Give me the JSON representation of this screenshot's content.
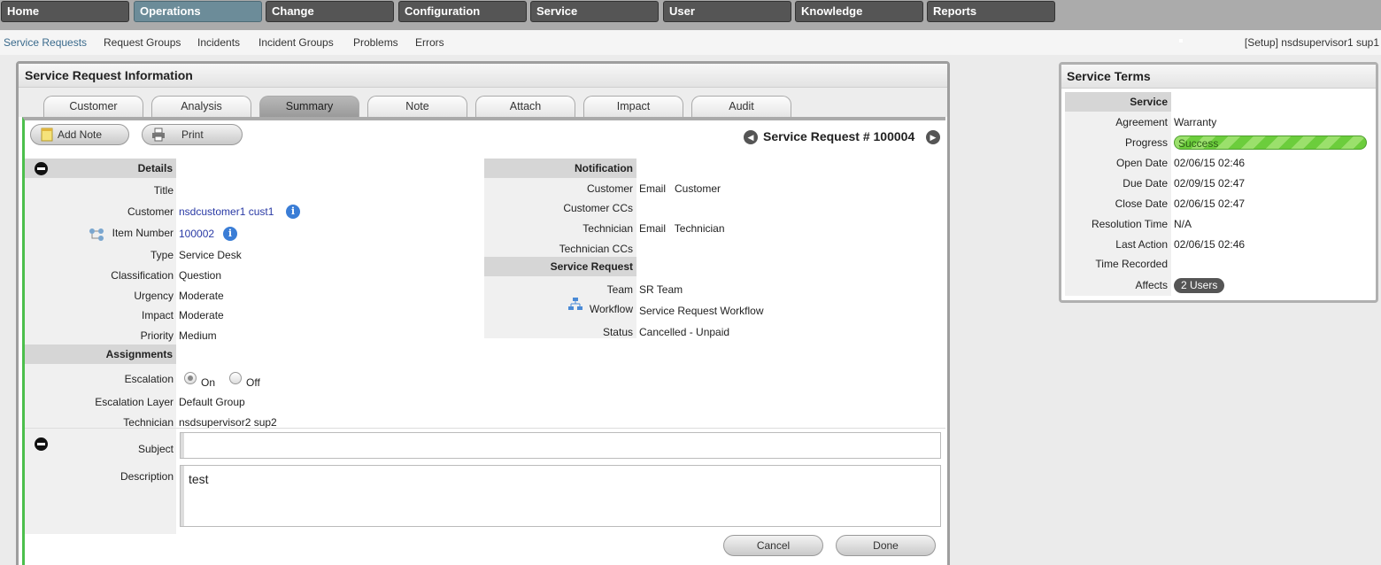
{
  "topnav": [
    "Home",
    "Operations",
    "Change",
    "Configuration",
    "Service",
    "User",
    "Knowledge",
    "Reports"
  ],
  "subnav": {
    "items": [
      "Service Requests",
      "Request Groups",
      "Incidents",
      "Incident Groups",
      "Problems",
      "Errors"
    ],
    "right": "[Setup]   nsdsupervisor1 sup1"
  },
  "panel": {
    "title": "Service Request Information",
    "tabs": [
      "Customer",
      "Analysis",
      "Summary",
      "Note",
      "Attach",
      "Impact",
      "Audit"
    ],
    "add_note": "Add Note",
    "print": "Print",
    "sr_title": "Service Request # 100004"
  },
  "details": {
    "header": "Details",
    "title_label": "Title",
    "customer_label": "Customer",
    "customer_value": "nsdcustomer1 cust1",
    "item_number_label": "Item Number",
    "item_number_value": "100002",
    "type_label": "Type",
    "type_value": "Service Desk",
    "classification_label": "Classification",
    "classification_value": "Question",
    "urgency_label": "Urgency",
    "urgency_value": "Moderate",
    "impact_label": "Impact",
    "impact_value": "Moderate",
    "priority_label": "Priority",
    "priority_value": "Medium"
  },
  "assignments": {
    "header": "Assignments",
    "escalation_label": "Escalation",
    "on": "On",
    "off": "Off",
    "layer_label": "Escalation Layer",
    "layer_value": "Default Group",
    "technician_label": "Technician",
    "technician_value": "nsdsupervisor2 sup2"
  },
  "notification": {
    "header": "Notification",
    "customer_label": "Customer",
    "customer_value": "Email   Customer",
    "customer_ccs_label": "Customer CCs",
    "technician_label": "Technician",
    "technician_value": "Email   Technician",
    "technician_ccs_label": "Technician CCs"
  },
  "service_request": {
    "header": "Service Request",
    "team_label": "Team",
    "team_value": "SR Team",
    "workflow_label": "Workflow",
    "workflow_value": "Service Request Workflow",
    "status_label": "Status",
    "status_value": "Cancelled - Unpaid"
  },
  "form": {
    "subject_label": "Subject",
    "subject_value": "",
    "description_label": "Description",
    "description_value": "test",
    "cancel": "Cancel",
    "done": "Done"
  },
  "terms": {
    "title": "Service Terms",
    "service_label": "Service",
    "agreement_label": "Agreement",
    "agreement_value": "Warranty",
    "progress_label": "Progress",
    "progress_value": "Success",
    "progress_fraction": 1.0,
    "open_label": "Open Date",
    "open_value": "02/06/15 02:46",
    "due_label": "Due Date",
    "due_value": "02/09/15 02:47",
    "close_label": "Close Date",
    "close_value": "02/06/15 02:47",
    "resolution_label": "Resolution Time",
    "resolution_value": "N/A",
    "last_action_label": "Last Action",
    "last_action_value": "02/06/15 02:46",
    "time_recorded_label": "Time Recorded",
    "affects_label": "Affects",
    "affects_value": "2 Users"
  }
}
